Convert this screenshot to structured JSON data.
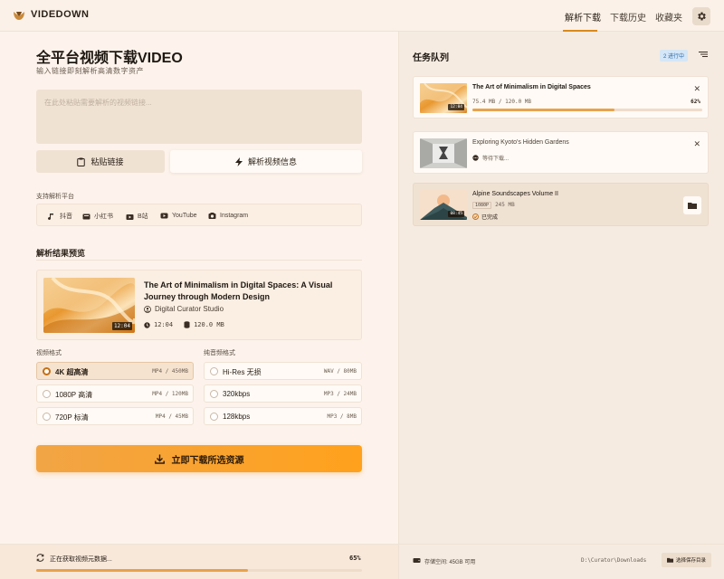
{
  "app": {
    "brand": "VIDEDOWN"
  },
  "nav": {
    "items": [
      "解析下载",
      "下载历史",
      "收藏夹"
    ],
    "active": 0
  },
  "main": {
    "title": "全平台视频下载VIDEO",
    "subtitle": "输入链接即刻解析高清数字资产",
    "url_placeholder": "在此处粘贴需要解析的视频链接...",
    "paste_label": "粘贴链接",
    "parse_label": "解析视频信息",
    "platforms_label": "支持解析平台",
    "platforms": [
      "抖音",
      "小红书",
      "B站",
      "YouTube",
      "Instagram"
    ],
    "results_label": "解析结果预览"
  },
  "preview": {
    "title": "The Art of Minimalism in Digital Spaces: A Visual Journey through Modern Design",
    "channel": "Digital Curator Studio",
    "duration": "12:04",
    "badge_duration": "12:04",
    "size": "120.0 MB"
  },
  "formats": {
    "video_label": "视频格式",
    "audio_label": "纯音频格式",
    "video": [
      {
        "name": "4K 超高清",
        "info": "MP4 / 450MB",
        "selected": true
      },
      {
        "name": "1080P 高清",
        "info": "MP4 / 120MB",
        "selected": false
      },
      {
        "name": "720P 标清",
        "info": "MP4 / 45MB",
        "selected": false
      }
    ],
    "audio": [
      {
        "name": "Hi-Res 无损",
        "info": "WAV / 80MB",
        "selected": false
      },
      {
        "name": "320kbps",
        "info": "MP3 / 24MB",
        "selected": false
      },
      {
        "name": "128kbps",
        "info": "MP3 / 8MB",
        "selected": false
      }
    ]
  },
  "download_button": "立即下载所选资源",
  "status": {
    "text": "正在获取视频元数据...",
    "percent_label": "65%",
    "progress": 0.65
  },
  "queue": {
    "title": "任务队列",
    "badge": "2 进行中",
    "items": [
      {
        "title": "The Art of Minimalism in Digital Spaces",
        "sub": "75.4 MB / 120.0 MB",
        "percent_label": "62%",
        "progress": 0.62,
        "thumb_badge": "12:04"
      },
      {
        "title": "Exploring Kyoto's Hidden Gardens",
        "sub": "等待下载..."
      },
      {
        "title": "Alpine Soundscapes Volume II",
        "tag": "1080P",
        "size": "245 MB",
        "status": "已完成",
        "thumb_badge": "08:45"
      }
    ]
  },
  "storage": {
    "label": "存储空间: 45GB 可用",
    "path": "D:\\Curator\\Downloads",
    "change_label": "选择保存目录"
  },
  "colors": {
    "accent": "#f2a545",
    "brand": "#c56f12",
    "progress": "#e8a24b"
  }
}
